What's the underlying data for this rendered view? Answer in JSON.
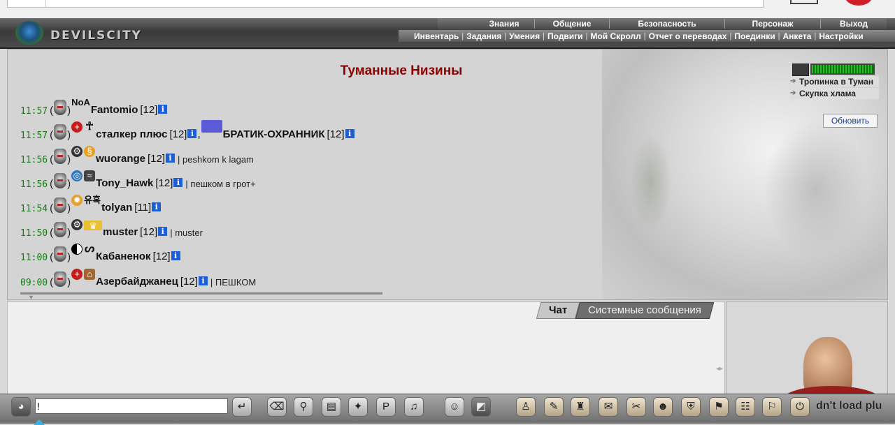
{
  "header": {
    "logo_text": "DEVILSCITY",
    "nav_main": [
      "Знания",
      "Общение",
      "Безопасность",
      "Персонаж",
      "Выход"
    ],
    "nav_sub": [
      "Инвентарь",
      "Задания",
      "Умения",
      "Подвиги",
      "Мой Скролл",
      "Отчет о переводах",
      "Поединки",
      "Анкета",
      "Настройки"
    ]
  },
  "location": {
    "title": "Туманные Низины",
    "links": [
      "Тропинка в Туман",
      "Скупка хлама"
    ],
    "refresh_label": "Обновить"
  },
  "players": [
    {
      "time": "11:57",
      "icons": [
        "NoA"
      ],
      "name": "Fantomio",
      "level": "[12]",
      "message": ""
    },
    {
      "time": "11:57",
      "icons": [
        "red-cross",
        "ankh"
      ],
      "name": "сталкер плюс",
      "level": "[12]",
      "extra_name": "БРАТИК-ОХРАННИК",
      "extra_level": "[12]",
      "message": ""
    },
    {
      "time": "11:56",
      "icons": [
        "gear",
        "swirl"
      ],
      "name": "wuorange",
      "level": "[12]",
      "message": "| peshkom k lagam"
    },
    {
      "time": "11:56",
      "icons": [
        "blue",
        "wings"
      ],
      "name": "Tony_Hawk",
      "level": "[12]",
      "message": "| пешком в грот+"
    },
    {
      "time": "11:54",
      "icons": [
        "orange",
        "유혹"
      ],
      "name": "tolyan",
      "level": "[11]",
      "message": ""
    },
    {
      "time": "11:50",
      "icons": [
        "gear",
        "crown"
      ],
      "name": "muster",
      "level": "[12]",
      "message": "| muster"
    },
    {
      "time": "11:00",
      "icons": [
        "yin",
        "squirrel"
      ],
      "name": "Кабаненок",
      "level": "[12]",
      "message": ""
    },
    {
      "time": "09:00",
      "icons": [
        "red-cross",
        "house"
      ],
      "name": "Азербайджанец",
      "level": "[12]",
      "message": "| ПЕШКОМ"
    }
  ],
  "chat": {
    "tabs": [
      "Чат",
      "Системные сообщения"
    ],
    "input_value": "!",
    "tail_text": "dn't load plu"
  },
  "symbols": {
    "open": "(",
    "close": ")",
    "comma": ",",
    "info": "i"
  },
  "colors": {
    "title": "#8b0000",
    "time": "#137c13",
    "info": "#1d5fd6"
  }
}
